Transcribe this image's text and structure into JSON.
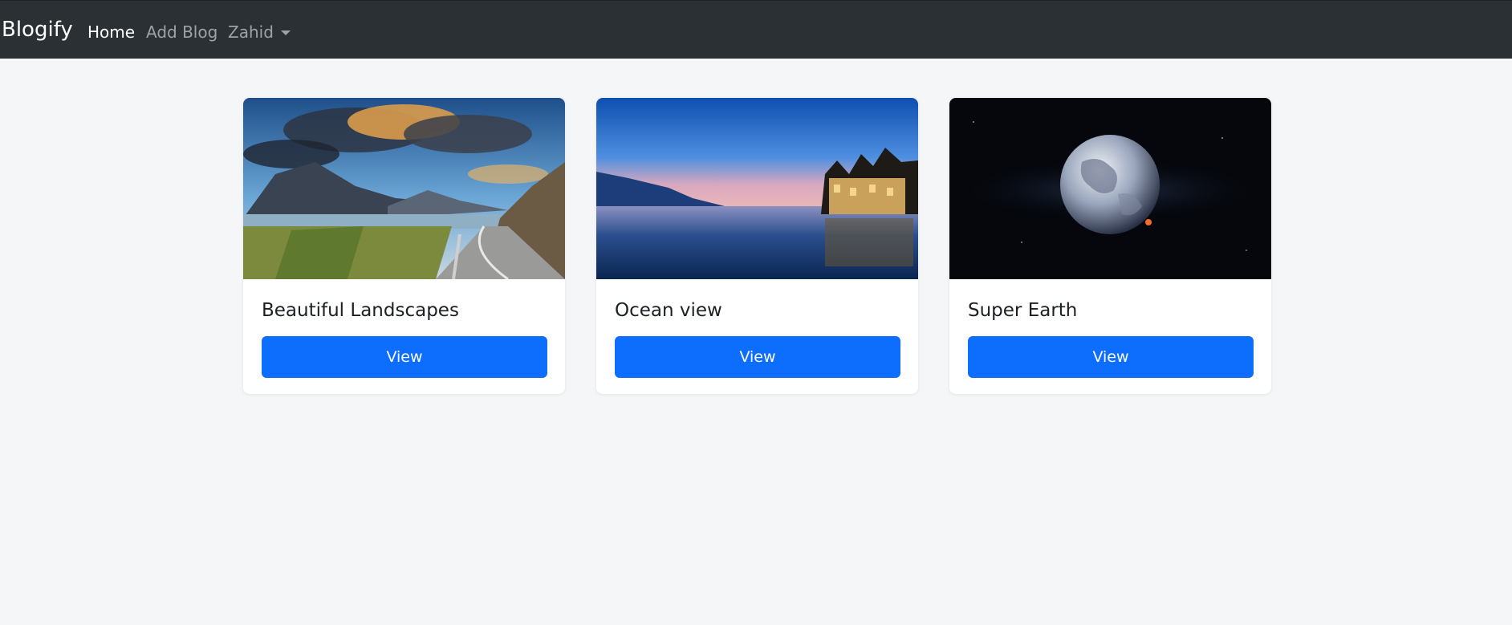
{
  "navbar": {
    "brand": "Blogify",
    "links": [
      {
        "label": "Home",
        "active": true
      },
      {
        "label": "Add Blog",
        "active": false
      }
    ],
    "user_menu": {
      "label": "Zahid",
      "icon": "caret-down-icon"
    }
  },
  "colors": {
    "navbar_bg": "#2b3035",
    "page_bg": "#f5f6f8",
    "primary_button": "#0d6efd"
  },
  "cards": [
    {
      "title": "Beautiful Landscapes",
      "button_label": "View",
      "image": "mountain-lake-road-photo"
    },
    {
      "title": "Ocean view",
      "button_label": "View",
      "image": "lake-castle-dusk-photo"
    },
    {
      "title": "Super Earth",
      "button_label": "View",
      "image": "earth-in-space-photo"
    }
  ]
}
